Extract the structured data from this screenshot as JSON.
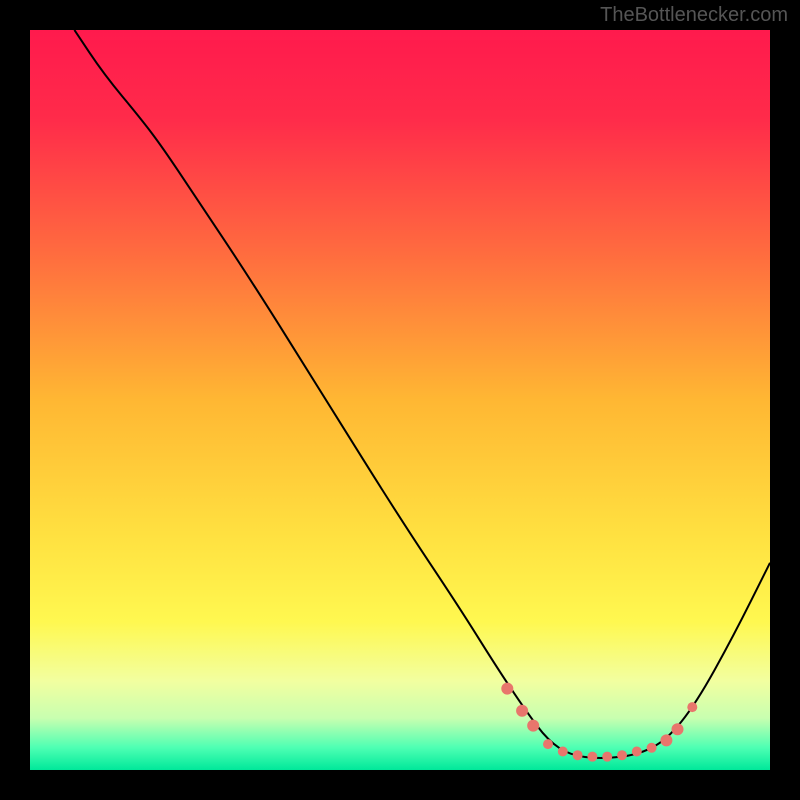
{
  "watermark": "TheBottlenecker.com",
  "chart_data": {
    "type": "line",
    "title": "",
    "xlabel": "",
    "ylabel": "",
    "xlim": [
      0,
      100
    ],
    "ylim": [
      0,
      100
    ],
    "background_gradient": {
      "stops": [
        {
          "pos": 0,
          "color": "#ff1a4d"
        },
        {
          "pos": 12,
          "color": "#ff2b4a"
        },
        {
          "pos": 30,
          "color": "#ff6b3f"
        },
        {
          "pos": 50,
          "color": "#ffb733"
        },
        {
          "pos": 68,
          "color": "#ffe040"
        },
        {
          "pos": 80,
          "color": "#fff850"
        },
        {
          "pos": 88,
          "color": "#f2ffa0"
        },
        {
          "pos": 93,
          "color": "#c8ffb0"
        },
        {
          "pos": 97,
          "color": "#4dffb3"
        },
        {
          "pos": 100,
          "color": "#00e89a"
        }
      ]
    },
    "series": [
      {
        "name": "curve",
        "color": "#000000",
        "stroke_width": 2,
        "points": [
          {
            "x": 6,
            "y": 100
          },
          {
            "x": 10,
            "y": 94
          },
          {
            "x": 15,
            "y": 88
          },
          {
            "x": 18,
            "y": 84
          },
          {
            "x": 22,
            "y": 78
          },
          {
            "x": 30,
            "y": 66
          },
          {
            "x": 40,
            "y": 50
          },
          {
            "x": 50,
            "y": 34
          },
          {
            "x": 58,
            "y": 22
          },
          {
            "x": 63,
            "y": 14
          },
          {
            "x": 67,
            "y": 8
          },
          {
            "x": 70,
            "y": 4
          },
          {
            "x": 73,
            "y": 2
          },
          {
            "x": 77,
            "y": 1.5
          },
          {
            "x": 82,
            "y": 2
          },
          {
            "x": 86,
            "y": 4
          },
          {
            "x": 90,
            "y": 9
          },
          {
            "x": 95,
            "y": 18
          },
          {
            "x": 100,
            "y": 28
          }
        ]
      }
    ],
    "markers": [
      {
        "x": 64.5,
        "y": 11,
        "size": 6,
        "color": "#e8766c"
      },
      {
        "x": 66.5,
        "y": 8,
        "size": 6,
        "color": "#e8766c"
      },
      {
        "x": 68,
        "y": 6,
        "size": 6,
        "color": "#e8766c"
      },
      {
        "x": 70,
        "y": 3.5,
        "size": 5,
        "color": "#e8766c"
      },
      {
        "x": 72,
        "y": 2.5,
        "size": 5,
        "color": "#e8766c"
      },
      {
        "x": 74,
        "y": 2,
        "size": 5,
        "color": "#e8766c"
      },
      {
        "x": 76,
        "y": 1.8,
        "size": 5,
        "color": "#e8766c"
      },
      {
        "x": 78,
        "y": 1.8,
        "size": 5,
        "color": "#e8766c"
      },
      {
        "x": 80,
        "y": 2,
        "size": 5,
        "color": "#e8766c"
      },
      {
        "x": 82,
        "y": 2.5,
        "size": 5,
        "color": "#e8766c"
      },
      {
        "x": 84,
        "y": 3,
        "size": 5,
        "color": "#e8766c"
      },
      {
        "x": 86,
        "y": 4,
        "size": 6,
        "color": "#e8766c"
      },
      {
        "x": 87.5,
        "y": 5.5,
        "size": 6,
        "color": "#e8766c"
      },
      {
        "x": 89.5,
        "y": 8.5,
        "size": 5,
        "color": "#e8766c"
      }
    ]
  }
}
